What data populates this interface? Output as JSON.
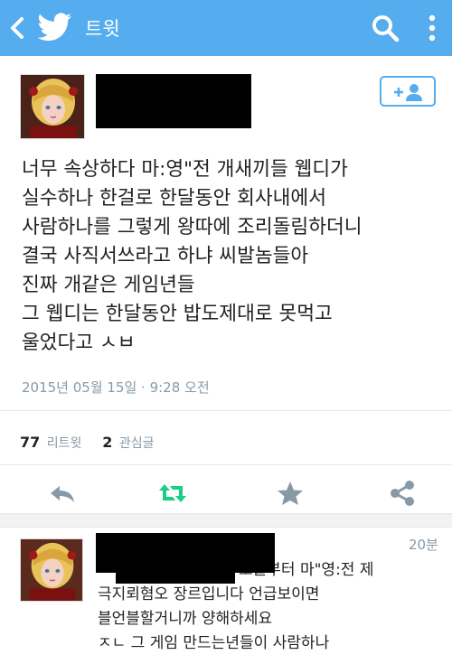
{
  "appbar": {
    "title": "트윗"
  },
  "tweet": {
    "lines": [
      "너무 속상하다 마:영\"전 개새끼들 웹디가",
      "실수하나 한걸로 한달동안 회사내에서",
      "사람하나를 그렇게 왕따에 조리돌림하더니",
      "결국 사직서쓰라고 하냐 씨발놈들아",
      "진짜 개같은 게임년들",
      "그 웹디는 한달동안 밥도제대로 못먹고",
      "울었다고 ㅅㅂ"
    ],
    "timestamp": "2015년 05월 15일 · 9:28 오전",
    "retweet_count": "77",
    "retweet_label": "리트윗",
    "favorite_count": "2",
    "favorite_label": "관심글"
  },
  "reply": {
    "time": "20분",
    "lines": [
      "오늘부터 마\"영:전 제",
      "극지뢰혐오 장르입니다 언급보이면",
      "블언블할거니까 양해하세요",
      "ㅈㄴ 그 게임 만드는년들이 사람하나"
    ]
  },
  "colors": {
    "accent": "#55acee",
    "retweet": "#19cf86",
    "muted": "#8899a6"
  },
  "icons": [
    "back-chevron-icon",
    "twitter-bird-icon",
    "search-icon",
    "more-vert-icon",
    "follow-person-icon",
    "reply-icon",
    "retweet-icon",
    "star-icon",
    "share-icon"
  ]
}
